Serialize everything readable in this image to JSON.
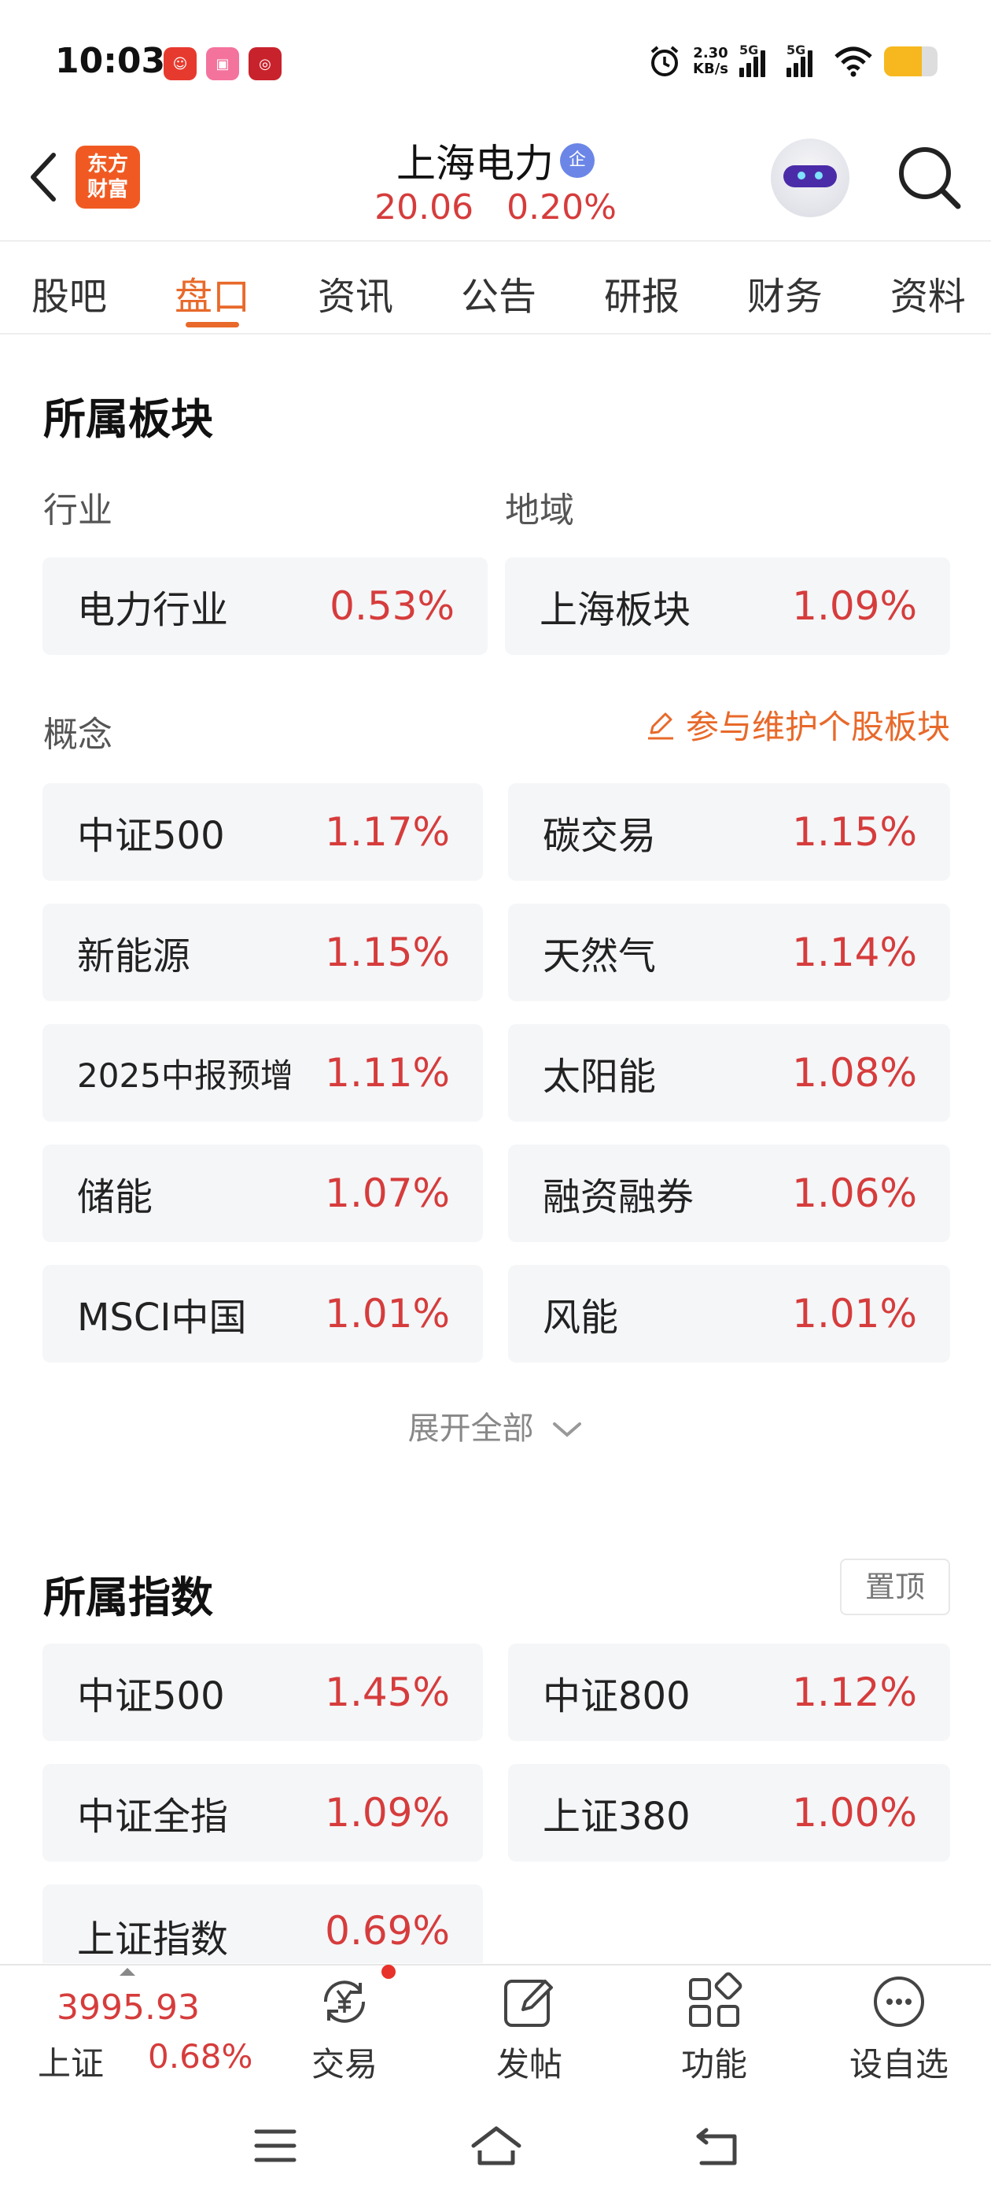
{
  "status_bar": {
    "time": "10:03",
    "net_speed_value": "2.30",
    "net_speed_unit": "KB/s",
    "sim1": "5G",
    "sim2": "5G",
    "battery_color": "#f6b81e"
  },
  "header": {
    "logo_line1": "东方",
    "logo_line2": "财富",
    "stock_name": "上海电力",
    "badge": "企",
    "price": "20.06",
    "change_pct": "0.20%"
  },
  "tabs": [
    "股吧",
    "盘口",
    "资讯",
    "公告",
    "研报",
    "财务",
    "资料"
  ],
  "active_tab": "盘口",
  "sectors": {
    "title": "所属板块",
    "industry_label": "行业",
    "region_label": "地域",
    "industry": {
      "name": "电力行业",
      "pct": "0.53%"
    },
    "region": {
      "name": "上海板块",
      "pct": "1.09%"
    },
    "concept_label": "概念",
    "maintain_link": "参与维护个股板块",
    "concepts": [
      {
        "name": "中证500",
        "pct": "1.17%"
      },
      {
        "name": "碳交易",
        "pct": "1.15%"
      },
      {
        "name": "新能源",
        "pct": "1.15%"
      },
      {
        "name": "天然气",
        "pct": "1.14%"
      },
      {
        "name": "2025中报预增",
        "pct": "1.11%"
      },
      {
        "name": "太阳能",
        "pct": "1.08%"
      },
      {
        "name": "储能",
        "pct": "1.07%"
      },
      {
        "name": "融资融券",
        "pct": "1.06%"
      },
      {
        "name": "MSCI中国",
        "pct": "1.01%"
      },
      {
        "name": "风能",
        "pct": "1.01%"
      }
    ],
    "expand_label": "展开全部"
  },
  "indices": {
    "title": "所属指数",
    "pin_label": "置顶",
    "items": [
      {
        "name": "中证500",
        "pct": "1.45%"
      },
      {
        "name": "中证800",
        "pct": "1.12%"
      },
      {
        "name": "中证全指",
        "pct": "1.09%"
      },
      {
        "name": "上证380",
        "pct": "1.00%"
      },
      {
        "name": "上证指数",
        "pct": "0.69%"
      }
    ]
  },
  "toolbar": {
    "index_value": "3995.93",
    "index_name": "上证",
    "index_pct": "0.68%",
    "trade_label": "交易",
    "post_label": "发帖",
    "function_label": "功能",
    "watchlist_label": "设自选"
  },
  "colors": {
    "accent": "#e8692a",
    "up_red": "#d63c3c",
    "card_bg": "#f5f6f8"
  }
}
